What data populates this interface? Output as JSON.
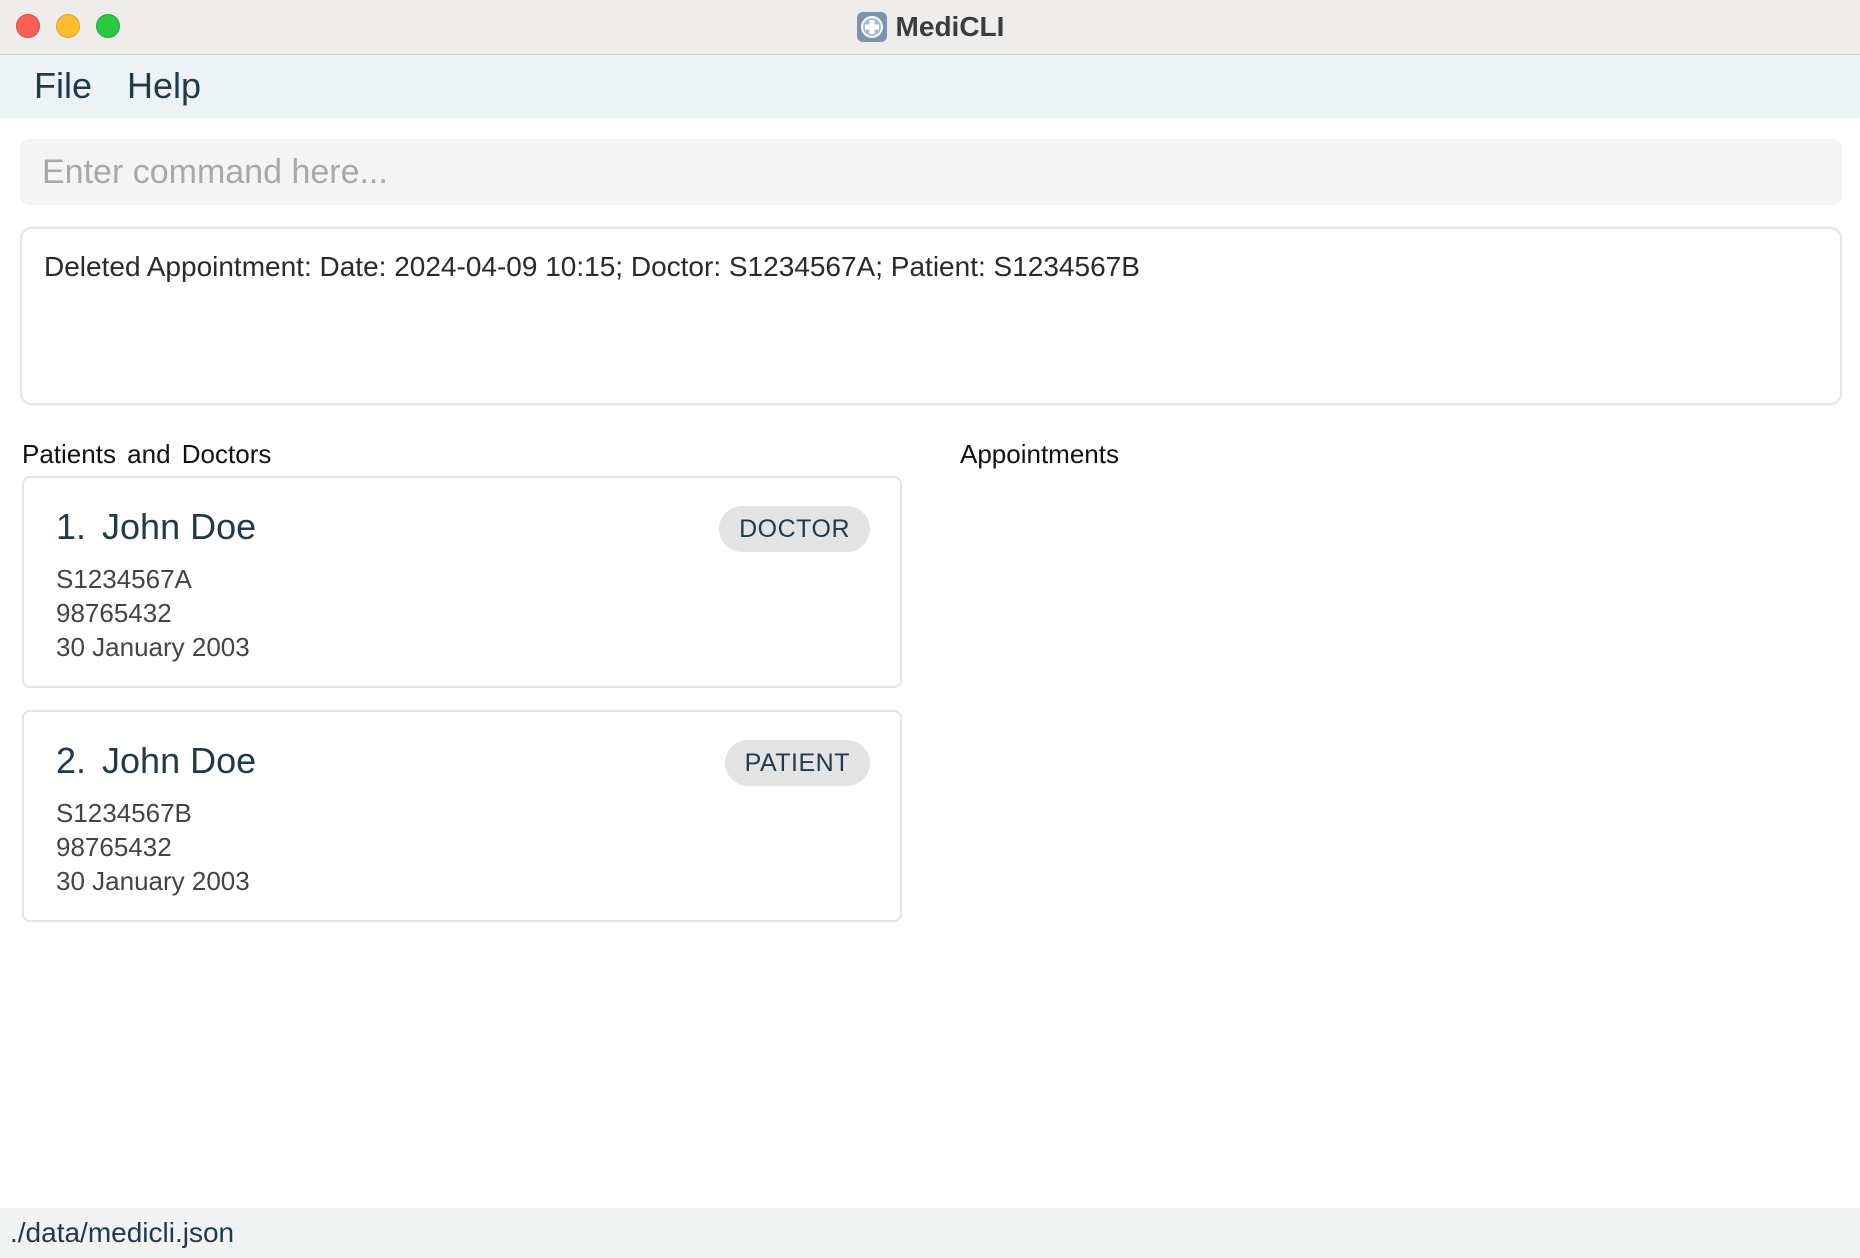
{
  "window": {
    "title": "MediCLI",
    "app_icon": "medical-cross-icon"
  },
  "menu": {
    "items": [
      {
        "label": "File"
      },
      {
        "label": "Help"
      }
    ]
  },
  "command": {
    "placeholder": "Enter command here...",
    "value": ""
  },
  "result": {
    "message": "Deleted Appointment: Date: 2024-04-09 10:15; Doctor: S1234567A; Patient: S1234567B"
  },
  "persons_panel": {
    "title": "Patients and Doctors",
    "cards": [
      {
        "index": "1.",
        "name": "John Doe",
        "tag": "DOCTOR",
        "nric": "S1234567A",
        "phone": "98765432",
        "dob": "30 January 2003"
      },
      {
        "index": "2.",
        "name": "John Doe",
        "tag": "PATIENT",
        "nric": "S1234567B",
        "phone": "98765432",
        "dob": "30 January 2003"
      }
    ]
  },
  "appointments_panel": {
    "title": "Appointments"
  },
  "status": {
    "file_path": "./data/medicli.json"
  },
  "colors": {
    "accent_text": "#1f3a4d",
    "tag_background": "#e3e3e3",
    "traffic_close": "#fe5f57",
    "traffic_minimize": "#febc2e",
    "traffic_maximize": "#28c840"
  }
}
